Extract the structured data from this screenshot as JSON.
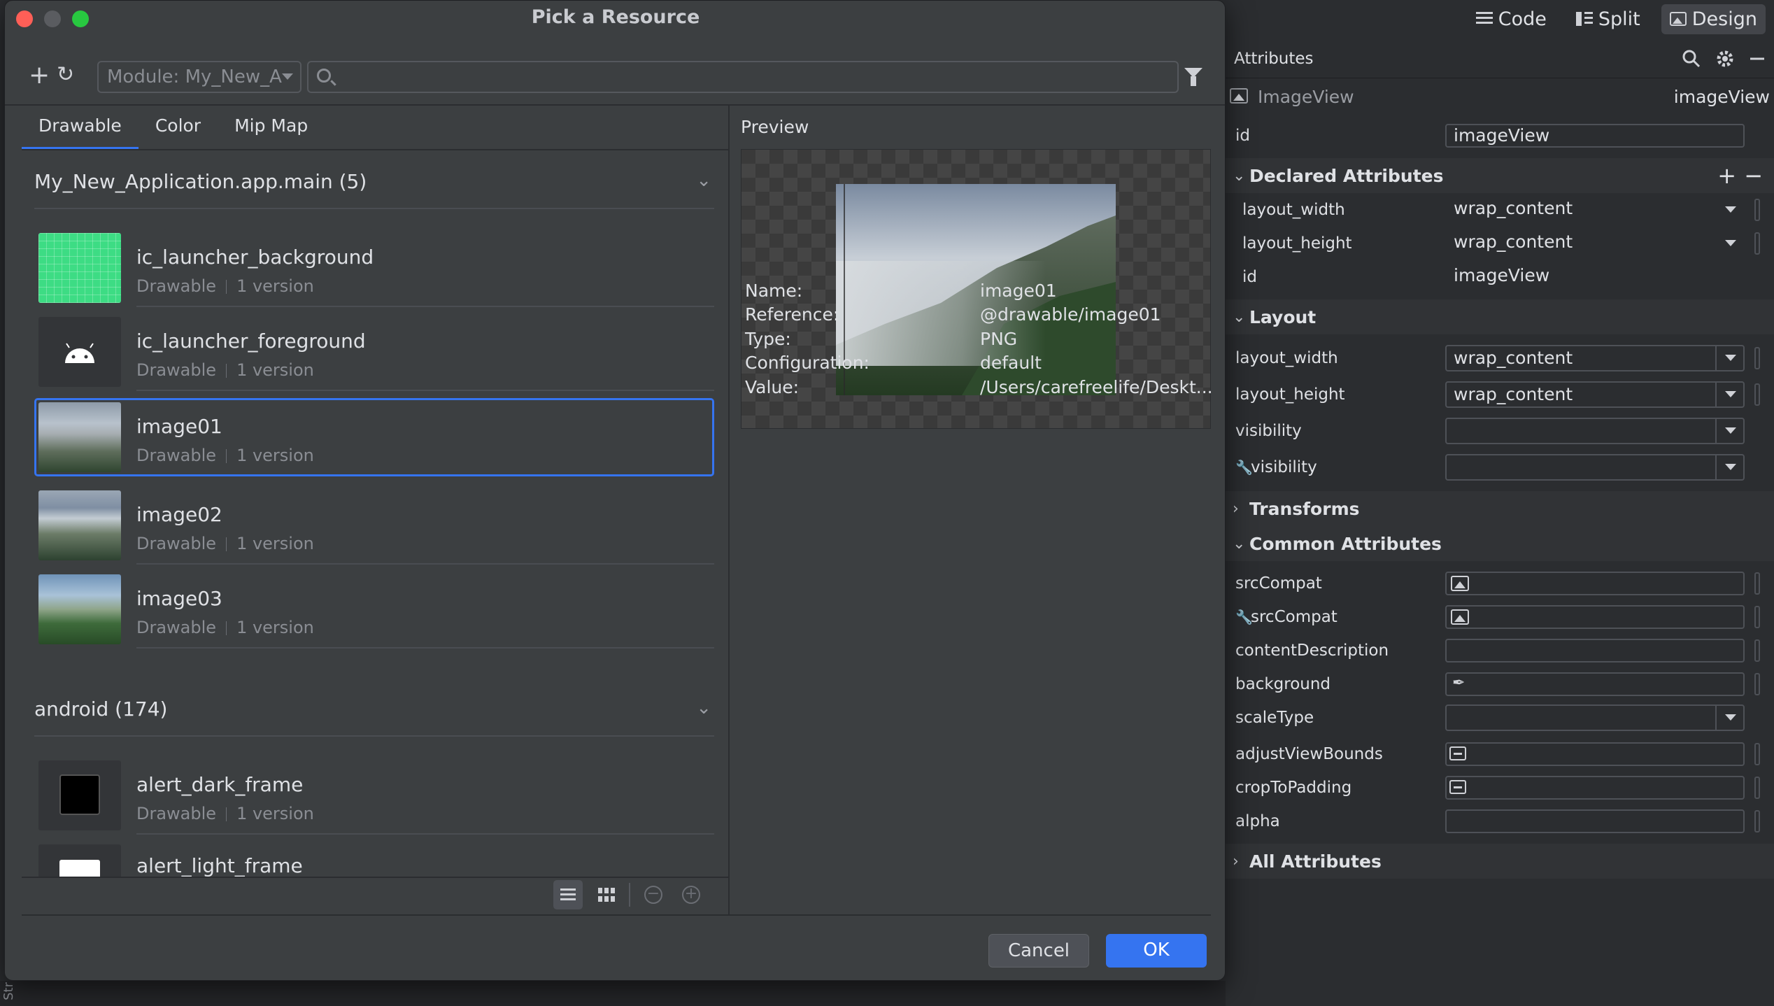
{
  "colors": {
    "accent": "#3574f0",
    "close": "#ff5f57",
    "minimize": "#5a5c60",
    "zoom": "#28c840"
  },
  "editor_modes": {
    "code": "Code",
    "split": "Split",
    "design": "Design"
  },
  "attributes": {
    "title": "Attributes",
    "view_class": "ImageView",
    "view_id_display": "imageView",
    "id_label": "id",
    "id_value": "imageView",
    "declared": {
      "title": "Declared Attributes",
      "rows": [
        {
          "name": "layout_width",
          "value": "wrap_content"
        },
        {
          "name": "layout_height",
          "value": "wrap_content"
        },
        {
          "name": "id",
          "value": "imageView"
        }
      ]
    },
    "layout": {
      "title": "Layout",
      "rows": [
        {
          "name": "layout_width",
          "value": "wrap_content"
        },
        {
          "name": "layout_height",
          "value": "wrap_content"
        },
        {
          "name": "visibility",
          "value": ""
        },
        {
          "name": "visibility",
          "value": ""
        }
      ]
    },
    "transforms_title": "Transforms",
    "common": {
      "title": "Common Attributes",
      "rows": [
        {
          "name": "srcCompat"
        },
        {
          "name": "srcCompat"
        },
        {
          "name": "contentDescription"
        },
        {
          "name": "background"
        },
        {
          "name": "scaleType"
        },
        {
          "name": "adjustViewBounds"
        },
        {
          "name": "cropToPadding"
        },
        {
          "name": "alpha"
        }
      ]
    },
    "all_title": "All Attributes"
  },
  "dialog": {
    "title": "Pick a Resource",
    "module_select": "Module: My_New_A",
    "search_placeholder": "",
    "tabs": [
      "Drawable",
      "Color",
      "Mip Map"
    ],
    "groups": [
      {
        "header": "My_New_Application.app.main (5)",
        "items": [
          {
            "name": "ic_launcher_background",
            "type": "Drawable",
            "versions": "1 version"
          },
          {
            "name": "ic_launcher_foreground",
            "type": "Drawable",
            "versions": "1 version"
          },
          {
            "name": "image01",
            "type": "Drawable",
            "versions": "1 version"
          },
          {
            "name": "image02",
            "type": "Drawable",
            "versions": "1 version"
          },
          {
            "name": "image03",
            "type": "Drawable",
            "versions": "1 version"
          }
        ]
      },
      {
        "header": "android (174)",
        "items": [
          {
            "name": "alert_dark_frame",
            "type": "Drawable",
            "versions": "1 version"
          },
          {
            "name": "alert_light_frame"
          }
        ]
      }
    ],
    "preview": {
      "label": "Preview",
      "info": [
        {
          "key": "Name:",
          "value": "image01"
        },
        {
          "key": "Reference:",
          "value": "@drawable/image01"
        },
        {
          "key": "Type:",
          "value": "PNG"
        },
        {
          "key": "Configuration:",
          "value": "default"
        },
        {
          "key": "Value:",
          "value": "/Users/carefreelife/Deskt..."
        }
      ]
    },
    "cancel_label": "Cancel",
    "ok_label": "OK"
  },
  "background_fragment": "Str"
}
